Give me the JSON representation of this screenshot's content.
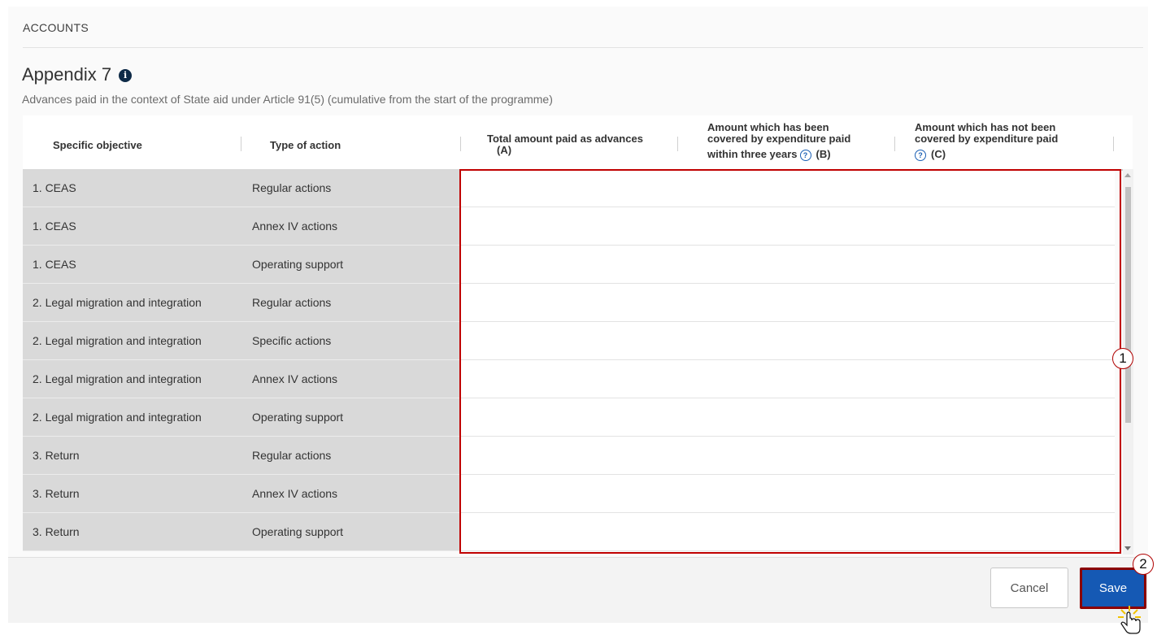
{
  "section": {
    "title": "ACCOUNTS"
  },
  "page": {
    "title": "Appendix 7",
    "subtitle": "Advances paid in the context of State aid under Article 91(5) (cumulative from the start of the programme)"
  },
  "table": {
    "headers": {
      "specific_objective": "Specific objective",
      "type_of_action": "Type of action",
      "col_a_line1": "Total amount paid as advances",
      "col_a_line2": "(A)",
      "col_b_line1": "Amount which has been",
      "col_b_line2": "covered by expenditure paid",
      "col_b_line3": "within three years",
      "col_b_tag": "(B)",
      "col_c_line1": "Amount which has not been",
      "col_c_line2": "covered by expenditure paid",
      "col_c_tag": "(C)"
    },
    "rows": [
      {
        "objective": "1. CEAS",
        "type": "Regular actions"
      },
      {
        "objective": "1. CEAS",
        "type": "Annex IV actions"
      },
      {
        "objective": "1. CEAS",
        "type": "Operating support"
      },
      {
        "objective": "2. Legal migration and integration",
        "type": "Regular actions"
      },
      {
        "objective": "2. Legal migration and integration",
        "type": "Specific actions"
      },
      {
        "objective": "2. Legal migration and integration",
        "type": "Annex IV actions"
      },
      {
        "objective": "2. Legal migration and integration",
        "type": "Operating support"
      },
      {
        "objective": "3. Return",
        "type": "Regular actions"
      },
      {
        "objective": "3. Return",
        "type": "Annex IV actions"
      },
      {
        "objective": "3. Return",
        "type": "Operating support"
      }
    ]
  },
  "footer": {
    "cancel_label": "Cancel",
    "save_label": "Save"
  },
  "callouts": {
    "one": "1",
    "two": "2"
  },
  "icons": {
    "info": "info-icon",
    "help": "help-circle-icon",
    "cursor": "hand-pointer-icon"
  },
  "colors": {
    "save_button": "#1559b4",
    "highlight_border": "#c00000",
    "left_cell_bg": "#d9d9d9"
  }
}
